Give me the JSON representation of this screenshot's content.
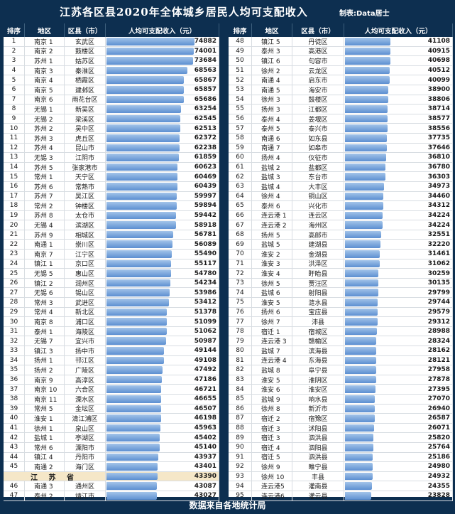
{
  "title": "江苏各区县2020年全体城乡居民人均可支配收入",
  "maker": "制表:Data居士",
  "footer": "数据来自各地统计局",
  "headers": {
    "rank": "排序",
    "region": "地区",
    "county": "区县（市）",
    "income": "人均可支配收入（元）"
  },
  "province_row": {
    "name": "江 苏 省",
    "value": 43390
  },
  "bar_color": "#5c8fd1",
  "max_value": 74882,
  "left_rows_a": [
    [
      "1",
      "南京 1",
      "玄武区",
      74882
    ],
    [
      "2",
      "南京 2",
      "鼓楼区",
      74001
    ],
    [
      "3",
      "苏州 1",
      "姑苏区",
      73684
    ],
    [
      "4",
      "南京 3",
      "秦淮区",
      68563
    ],
    [
      "5",
      "南京 4",
      "栖霞区",
      65867
    ],
    [
      "6",
      "南京 5",
      "建邺区",
      65857
    ],
    [
      "7",
      "南京 6",
      "雨花台区",
      65686
    ],
    [
      "8",
      "无锡 1",
      "新吴区",
      63254
    ],
    [
      "9",
      "无锡 2",
      "梁溪区",
      62545
    ],
    [
      "10",
      "苏州 2",
      "吴中区",
      62513
    ],
    [
      "11",
      "苏州 3",
      "虎丘区",
      62372
    ],
    [
      "12",
      "苏州 4",
      "昆山市",
      62238
    ],
    [
      "13",
      "无锡 3",
      "江阴市",
      61859
    ],
    [
      "14",
      "苏州 5",
      "张家港市",
      60623
    ],
    [
      "15",
      "常州 1",
      "天宁区",
      60469
    ],
    [
      "16",
      "苏州 6",
      "常熟市",
      60439
    ],
    [
      "17",
      "苏州 7",
      "吴江区",
      59997
    ],
    [
      "18",
      "常州 2",
      "钟楼区",
      59894
    ],
    [
      "19",
      "苏州 8",
      "太仓市",
      59442
    ],
    [
      "20",
      "无锡 4",
      "滨湖区",
      58918
    ],
    [
      "21",
      "苏州 9",
      "相城区",
      56781
    ],
    [
      "22",
      "南通 1",
      "崇川区",
      56089
    ],
    [
      "23",
      "南京 7",
      "江宁区",
      55490
    ],
    [
      "24",
      "镇江 1",
      "京口区",
      55117
    ],
    [
      "25",
      "无锡 5",
      "惠山区",
      54780
    ],
    [
      "26",
      "镇江 2",
      "润州区",
      54234
    ],
    [
      "27",
      "无锡 6",
      "锡山区",
      53986
    ],
    [
      "28",
      "常州 3",
      "武进区",
      53412
    ],
    [
      "29",
      "常州 4",
      "新北区",
      51378
    ],
    [
      "30",
      "南京 8",
      "浦口区",
      51099
    ],
    [
      "31",
      "泰州 1",
      "海陵区",
      51062
    ],
    [
      "32",
      "无锡 7",
      "宜兴市",
      50987
    ],
    [
      "33",
      "镇江 3",
      "扬中市",
      49144
    ],
    [
      "34",
      "扬州 1",
      "邗江区",
      49108
    ],
    [
      "35",
      "扬州 2",
      "广陵区",
      47492
    ],
    [
      "36",
      "南京 9",
      "高淳区",
      47186
    ],
    [
      "37",
      "南京 10",
      "六合区",
      46721
    ],
    [
      "38",
      "南京 11",
      "溧水区",
      46655
    ],
    [
      "39",
      "常州 5",
      "金坛区",
      46507
    ],
    [
      "40",
      "淮安 1",
      "清江浦区",
      46198
    ],
    [
      "41",
      "徐州 1",
      "泉山区",
      45963
    ],
    [
      "42",
      "盐城 1",
      "亭湖区",
      45402
    ],
    [
      "43",
      "常州 6",
      "溧阳市",
      45140
    ],
    [
      "44",
      "镇江 4",
      "丹阳市",
      43937
    ],
    [
      "45",
      "南通 2",
      "海门区",
      43401
    ]
  ],
  "left_rows_b": [
    [
      "46",
      "南通 3",
      "通州区",
      43087
    ],
    [
      "47",
      "泰州 2",
      "靖江市",
      43027
    ]
  ],
  "right_rows": [
    [
      "48",
      "镇江 5",
      "丹徒区",
      41108
    ],
    [
      "49",
      "泰州 3",
      "高港区",
      40915
    ],
    [
      "50",
      "镇江 6",
      "句容市",
      40698
    ],
    [
      "51",
      "徐州 2",
      "云龙区",
      40512
    ],
    [
      "52",
      "南通 4",
      "启东市",
      40099
    ],
    [
      "53",
      "南通 5",
      "海安市",
      38900
    ],
    [
      "54",
      "徐州 3",
      "鼓楼区",
      38806
    ],
    [
      "55",
      "扬州 3",
      "江都区",
      38714
    ],
    [
      "56",
      "泰州 4",
      "姜堰区",
      38577
    ],
    [
      "57",
      "泰州 5",
      "泰兴市",
      38556
    ],
    [
      "58",
      "南通 6",
      "如东县",
      37735
    ],
    [
      "59",
      "南通 7",
      "如皋市",
      37646
    ],
    [
      "60",
      "扬州 4",
      "仪征市",
      36810
    ],
    [
      "61",
      "盐城 2",
      "盐都区",
      36780
    ],
    [
      "62",
      "盐城 3",
      "东台市",
      36303
    ],
    [
      "63",
      "盐城 4",
      "大丰区",
      34973
    ],
    [
      "64",
      "徐州 4",
      "铜山区",
      34460
    ],
    [
      "65",
      "泰州 6",
      "兴化市",
      34312
    ],
    [
      "66",
      "连云港 1",
      "连云区",
      34224
    ],
    [
      "67",
      "连云港 2",
      "海州区",
      34224
    ],
    [
      "68",
      "扬州 5",
      "高邮市",
      32551
    ],
    [
      "69",
      "盐城 5",
      "建湖县",
      32220
    ],
    [
      "70",
      "淮安 2",
      "金湖县",
      31461
    ],
    [
      "71",
      "淮安 3",
      "洪泽区",
      31062
    ],
    [
      "72",
      "淮安 4",
      "盱眙县",
      30259
    ],
    [
      "73",
      "徐州 5",
      "贾汪区",
      30135
    ],
    [
      "74",
      "盐城 6",
      "射阳县",
      29799
    ],
    [
      "75",
      "淮安 5",
      "涟水县",
      29744
    ],
    [
      "76",
      "扬州 6",
      "宝应县",
      29579
    ],
    [
      "77",
      "徐州 7",
      "沛县",
      29312
    ],
    [
      "78",
      "宿迁 1",
      "宿城区",
      28988
    ],
    [
      "79",
      "连云港 3",
      "赣榆区",
      28324
    ],
    [
      "80",
      "盐城 7",
      "滨海县",
      28162
    ],
    [
      "81",
      "连云港 4",
      "东海县",
      28121
    ],
    [
      "82",
      "盐城 8",
      "阜宁县",
      27958
    ],
    [
      "83",
      "淮安 5",
      "淮阴区",
      27878
    ],
    [
      "84",
      "淮安 6",
      "淮安区",
      27395
    ],
    [
      "85",
      "盐城 9",
      "响水县",
      27070
    ],
    [
      "86",
      "徐州 8",
      "新沂市",
      26940
    ],
    [
      "87",
      "宿迁 2",
      "宿豫区",
      26587
    ],
    [
      "88",
      "宿迁 3",
      "沭阳县",
      26071
    ],
    [
      "89",
      "宿迁 3",
      "泗洪县",
      25820
    ],
    [
      "90",
      "宿迁 4",
      "泗阳县",
      25764
    ],
    [
      "91",
      "宿迁 5",
      "泗洪县",
      25186
    ],
    [
      "92",
      "徐州 9",
      "睢宁县",
      24980
    ],
    [
      "93",
      "徐州 10",
      "丰县",
      24932
    ],
    [
      "94",
      "连云港5",
      "灌南县",
      24355
    ],
    [
      "95",
      "连云港6",
      "灌云县",
      23828
    ]
  ]
}
